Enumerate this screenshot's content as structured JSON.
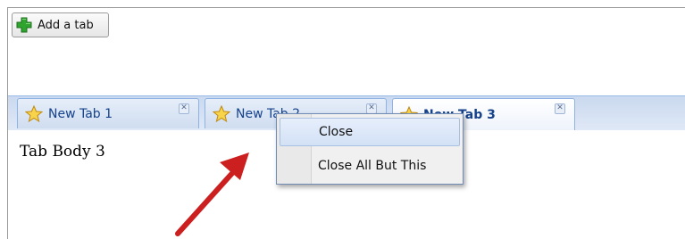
{
  "toolbar": {
    "add_tab_label": "Add a tab",
    "add_icon": "green-plus-icon"
  },
  "tabs": [
    {
      "label": "New Tab 1",
      "icon": "star-icon",
      "active": false
    },
    {
      "label": "New Tab 2",
      "icon": "star-icon",
      "active": false
    },
    {
      "label": "New Tab 3",
      "icon": "star-icon",
      "active": true
    }
  ],
  "tab_body": {
    "text": "Tab Body 3"
  },
  "context_menu": {
    "items": [
      {
        "label": "Close",
        "hovered": true
      },
      {
        "label": "Close All But This",
        "hovered": false
      }
    ]
  },
  "colors": {
    "tab_text": "#15428b",
    "tabbar_border": "#99bbe8",
    "arrow": "#cc1f1f",
    "plus": "#2fa52f"
  }
}
